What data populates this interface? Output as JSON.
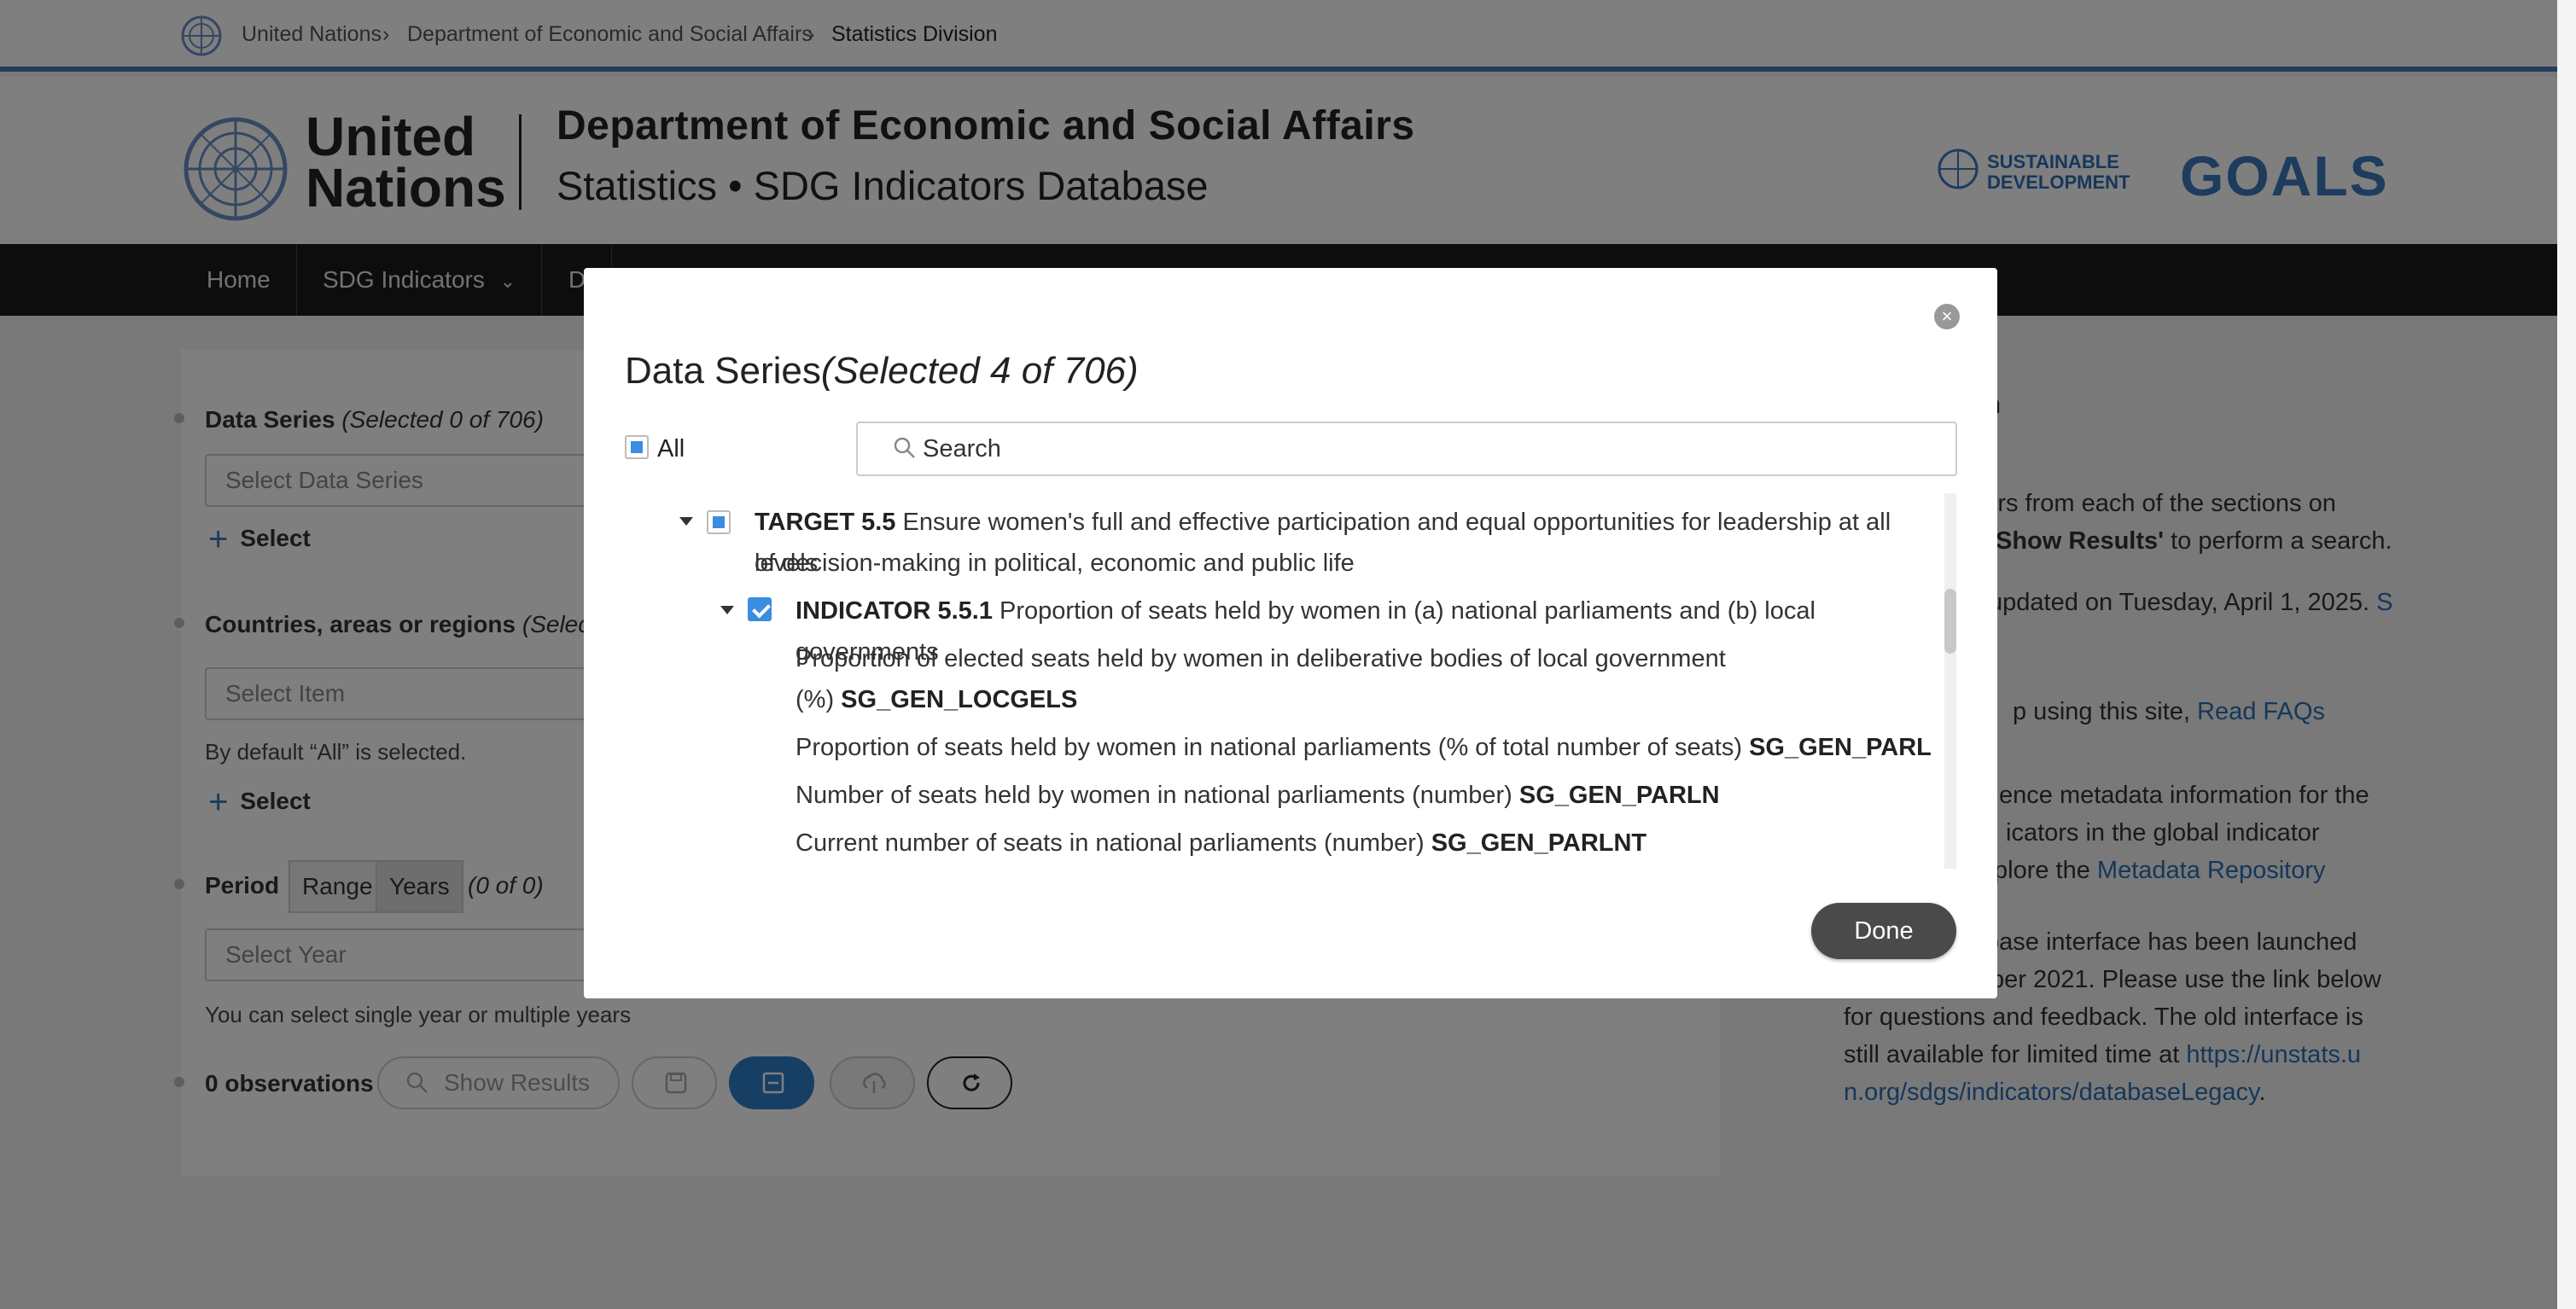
{
  "breadcrumb": {
    "items": [
      "United Nations",
      "Department of Economic and Social Affairs",
      "Statistics Division"
    ],
    "separator": ">"
  },
  "header": {
    "org_line1": "United",
    "org_line2": "Nations",
    "dept_title": "Department of Economic and Social Affairs",
    "dept_subtitle": "Statistics • SDG Indicators Database",
    "sdg_small_1": "SUSTAINABLE",
    "sdg_small_2": "DEVELOPMENT",
    "sdg_goals": "GOALS"
  },
  "nav": {
    "home": "Home",
    "sdg_indicators": "SDG Indicators",
    "dropdown_icon": "chevron-down-icon",
    "third_partial": "D"
  },
  "form": {
    "data_series_label": "Data Series",
    "data_series_count": "(Selected 0 of 706)",
    "data_series_placeholder": "Select Data Series",
    "select_label": "Select",
    "countries_label": "Countries, areas or regions",
    "countries_count": "(Selecte",
    "countries_placeholder": "Select Item",
    "default_note": "By default “All” is selected.",
    "period_label": "Period",
    "period_range": "Range",
    "period_years": "Years",
    "period_count": "(0 of 0)",
    "year_placeholder": "Select Year",
    "year_note": "You can select single year or multiple years",
    "observations": "0 observations",
    "show_results": "Show Results"
  },
  "right_panel": {
    "heading_partial": "ction",
    "p1_line1": "eters from each of the sections on",
    "p1_line2_bold": "Show Results'",
    "p1_line2_rest": " to perform a search.",
    "p2_line1": "updated on Tuesday, April 1, 2025.",
    "p2_link_partial": "S",
    "p3_line1": "p using this site,",
    "p3_link": "Read FAQs",
    "p4_line1": "ence metadata information for the",
    "p4_line2": "icators in the global indicator",
    "p4_line3": "plore the",
    "p4_link": "Metadata Repository",
    "p5_line1": "base interface has been launched",
    "p5_line2": "ber 2021. Please use the link below",
    "p5_line3": "for questions and feedback. The old interface is",
    "p5_line4": "still available for limited time at",
    "p5_link_1": "https://unstats.u",
    "p5_link_2": "n.org/sdgs/indicators/databaseLegacy",
    "p5_end": "."
  },
  "modal": {
    "title": "Data Series",
    "title_count": "(Selected 4 of 706)",
    "all_label": "All",
    "search_placeholder": "Search",
    "close_icon": "close-icon",
    "done_label": "Done",
    "target": {
      "code": "TARGET 5.5",
      "text_line1": "Ensure women's full and effective participation and equal opportunities for leadership at all levels",
      "text_line2": "of decision-making in political, economic and public life"
    },
    "indicator": {
      "code": "INDICATOR 5.5.1",
      "text": "Proportion of seats held by women in (a) national parliaments and (b) local governments"
    },
    "series": [
      {
        "text_line1": "Proportion of elected seats held by women in deliberative bodies of local government",
        "text_line2": "(%)",
        "code": "SG_GEN_LOCGELS"
      },
      {
        "text": "Proportion of seats held by women in national parliaments (% of total number of seats)",
        "code": "SG_GEN_PARL"
      },
      {
        "text": "Number of seats held by women in national parliaments (number)",
        "code": "SG_GEN_PARLN"
      },
      {
        "text": "Current number of seats in national parliaments (number)",
        "code": "SG_GEN_PARLNT"
      }
    ]
  }
}
